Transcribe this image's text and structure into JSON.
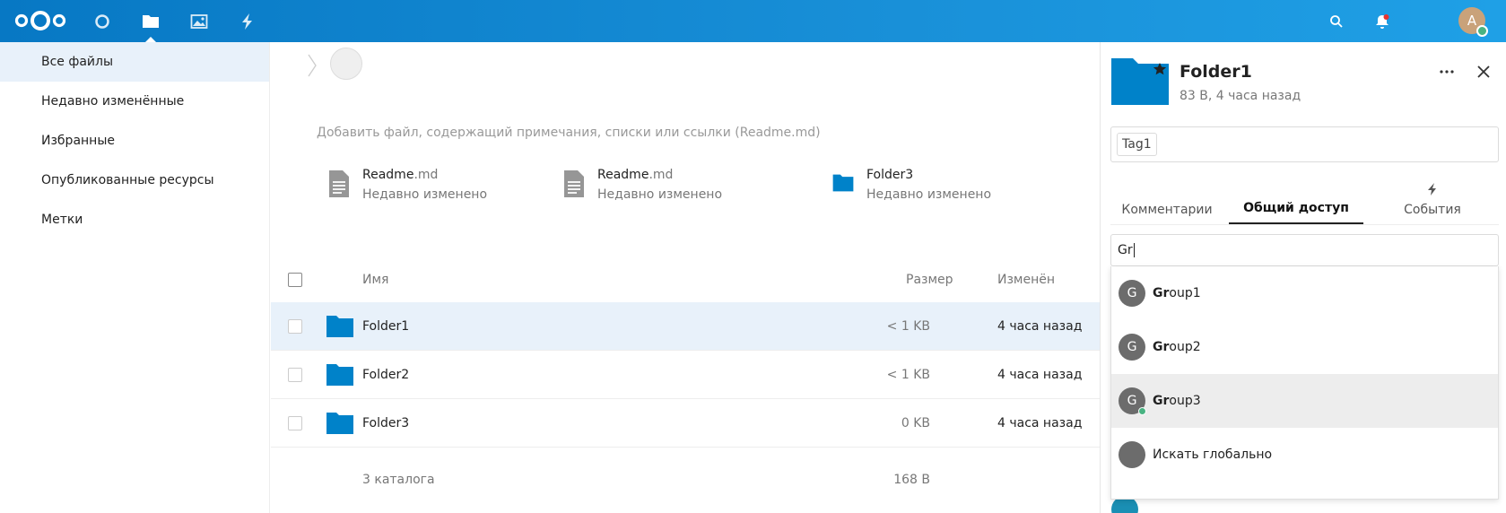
{
  "header": {
    "nav": [
      {
        "name": "dashboard",
        "icon": "circle-icon"
      },
      {
        "name": "files",
        "icon": "folder-icon",
        "active": true
      },
      {
        "name": "photos",
        "icon": "image-icon"
      },
      {
        "name": "activity",
        "icon": "lightning-icon"
      }
    ],
    "avatar_letter": "A"
  },
  "left_nav": {
    "items": [
      {
        "label": "Все файлы",
        "active": true
      },
      {
        "label": "Недавно изменённые"
      },
      {
        "label": "Избранные"
      },
      {
        "label": "Опубликованные ресурсы"
      },
      {
        "label": "Метки"
      }
    ]
  },
  "main": {
    "readme_hint": "Добавить файл, содержащий примечания, списки или ссылки (Readme.md)",
    "recent": [
      {
        "name": "Readme",
        "ext": ".md",
        "sub": "Недавно изменено",
        "icon": "document-icon"
      },
      {
        "name": "Readme",
        "ext": ".md",
        "sub": "Недавно изменено",
        "icon": "document-icon"
      },
      {
        "name": "Folder3",
        "ext": "",
        "sub": "Недавно изменено",
        "icon": "folder-icon"
      }
    ],
    "columns": {
      "name": "Имя",
      "size": "Размер",
      "modified": "Изменён"
    },
    "rows": [
      {
        "name": "Folder1",
        "size": "< 1 KB",
        "modified": "4 часа назад",
        "selected": true
      },
      {
        "name": "Folder2",
        "size": "< 1 KB",
        "modified": "4 часа назад"
      },
      {
        "name": "Folder3",
        "size": "0 KB",
        "modified": "4 часа назад"
      }
    ],
    "summary": {
      "count": "3 каталога",
      "size": "168 B"
    }
  },
  "sidebar": {
    "title": "Folder1",
    "subtitle": "83 B, 4 часа назад",
    "tag": "Tag1",
    "tabs": [
      {
        "label": "Комментарии"
      },
      {
        "label": "Общий доступ",
        "active": true
      },
      {
        "label": "События",
        "icon": "lightning-icon"
      }
    ],
    "share_input": "Gr",
    "suggestions": [
      {
        "avatar": "G",
        "bold": "Gr",
        "rest": "oup1"
      },
      {
        "avatar": "G",
        "bold": "Gr",
        "rest": "oup2"
      },
      {
        "avatar": "G",
        "bold": "Gr",
        "rest": "oup3",
        "hover": true,
        "online": true
      },
      {
        "avatar": "",
        "bold": "",
        "rest": "Искать глобально"
      }
    ]
  },
  "colors": {
    "header": "#0778c4",
    "folder": "#0082c9",
    "selected_row": "#e8f1fa",
    "online": "#49b382"
  }
}
